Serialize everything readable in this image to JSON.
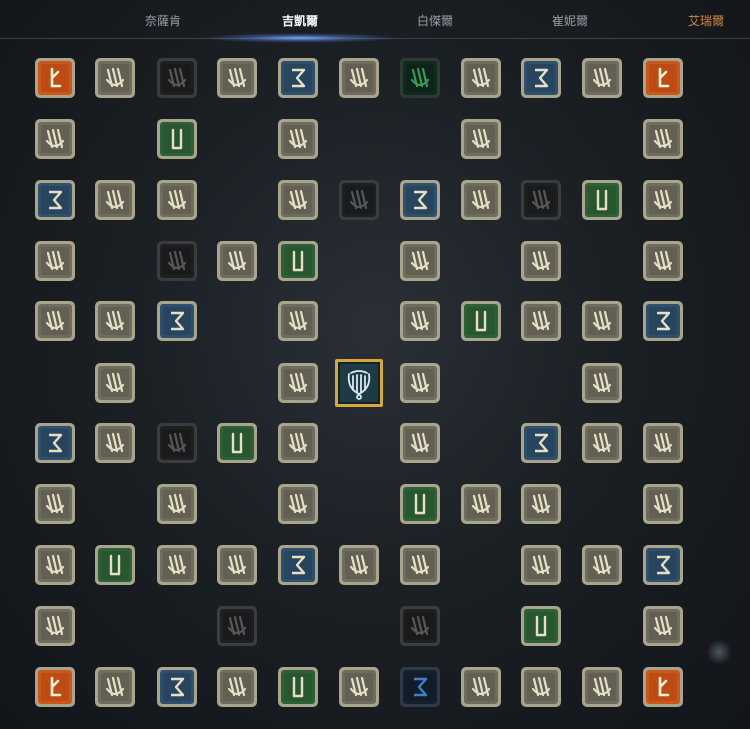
{
  "tabs": [
    {
      "label": "奈薩肯",
      "state": "normal"
    },
    {
      "label": "吉凱爾",
      "state": "active"
    },
    {
      "label": "白傑爾",
      "state": "normal"
    },
    {
      "label": "崔妮爾",
      "state": "normal"
    },
    {
      "label": "艾瑞爾",
      "state": "special"
    }
  ],
  "colors": {
    "ornate": "#7d7c6c",
    "blue": "#2f4f6a",
    "green": "#2f5f36",
    "dark": "#222426",
    "dark_green": "#102a1e",
    "dark_blue": "#15202c",
    "orange": "#c9581a",
    "center_border": "#d4a83a"
  },
  "legend_of_node_types": [
    "ornate",
    "blue",
    "green",
    "dark",
    "dark_green",
    "dark_blue",
    "orange"
  ],
  "grid": {
    "rows": [
      [
        "orange",
        "ornate",
        "dark",
        "ornate",
        "blue",
        "ornate",
        "dark_green",
        "ornate",
        "blue",
        "ornate",
        "orange"
      ],
      [
        "ornate",
        "",
        "green",
        "",
        "ornate",
        "",
        "",
        "ornate",
        "",
        "",
        "ornate"
      ],
      [
        "blue",
        "ornate",
        "ornate",
        "",
        "ornate",
        "dark",
        "blue",
        "ornate",
        "dark",
        "green",
        "ornate"
      ],
      [
        "ornate",
        "",
        "dark",
        "ornate",
        "green",
        "",
        "ornate",
        "",
        "ornate",
        "",
        "ornate"
      ],
      [
        "ornate",
        "ornate",
        "blue",
        "",
        "ornate",
        "",
        "ornate",
        "green",
        "ornate",
        "ornate",
        "blue"
      ],
      [
        "",
        "ornate",
        "",
        "",
        "ornate",
        "center",
        "ornate",
        "",
        "",
        "ornate",
        ""
      ],
      [
        "blue",
        "ornate",
        "dark",
        "green",
        "ornate",
        "",
        "ornate",
        "",
        "blue",
        "ornate",
        "ornate"
      ],
      [
        "ornate",
        "",
        "ornate",
        "",
        "ornate",
        "",
        "green",
        "ornate",
        "ornate",
        "",
        "ornate"
      ],
      [
        "ornate",
        "green",
        "ornate",
        "ornate",
        "blue",
        "ornate",
        "ornate",
        "",
        "ornate",
        "ornate",
        "blue"
      ],
      [
        "ornate",
        "",
        "",
        "dark",
        "",
        "",
        "dark",
        "",
        "green",
        "",
        "ornate"
      ],
      [
        "orange",
        "ornate",
        "blue",
        "ornate",
        "green",
        "ornate",
        "dark_blue",
        "ornate",
        "ornate",
        "ornate",
        "orange"
      ]
    ]
  },
  "center_node": {
    "icon": "lyre-emblem-icon"
  }
}
